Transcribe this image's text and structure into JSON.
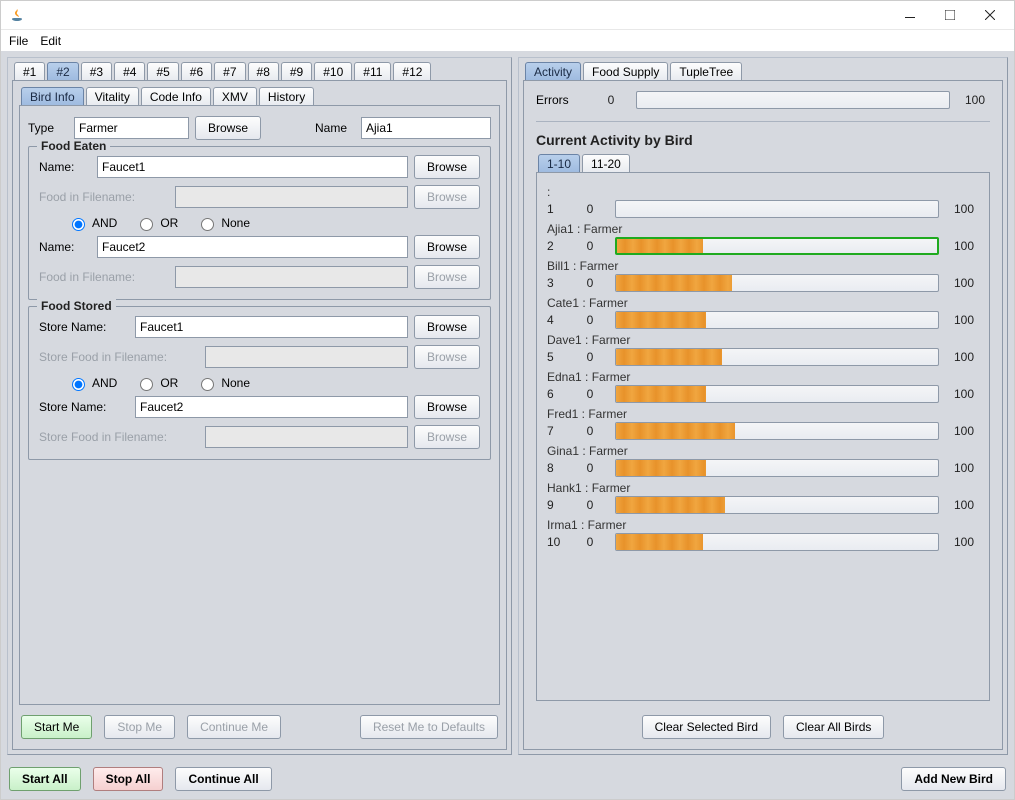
{
  "window": {
    "title": ""
  },
  "menu": {
    "items": [
      "File",
      "Edit"
    ]
  },
  "outer_tabs": [
    "#1",
    "#2",
    "#3",
    "#4",
    "#5",
    "#6",
    "#7",
    "#8",
    "#9",
    "#10",
    "#11",
    "#12"
  ],
  "outer_tabs_active": 1,
  "inner_tabs": [
    "Bird Info",
    "Vitality",
    "Code Info",
    "XMV",
    "History"
  ],
  "inner_tabs_active": 0,
  "bird_info": {
    "type_label": "Type",
    "type_value": "Farmer",
    "browse": "Browse",
    "name_label": "Name",
    "name_value": "Ajia1"
  },
  "food_eaten": {
    "legend": "Food Eaten",
    "name1_label": "Name:",
    "name1_value": "Faucet1",
    "file1_label": "Food in Filename:",
    "radio_and": "AND",
    "radio_or": "OR",
    "radio_none": "None",
    "radio_selected": "AND",
    "name2_label": "Name:",
    "name2_value": "Faucet2",
    "file2_label": "Food in Filename:",
    "browse": "Browse"
  },
  "food_stored": {
    "legend": "Food Stored",
    "store1_label": "Store Name:",
    "store1_value": "Faucet1",
    "file1_label": "Store Food in Filename:",
    "radio_and": "AND",
    "radio_or": "OR",
    "radio_none": "None",
    "radio_selected": "AND",
    "store2_label": "Store Name:",
    "store2_value": "Faucet2",
    "file2_label": "Store Food in Filename:",
    "browse": "Browse"
  },
  "bird_buttons": {
    "start": "Start Me",
    "stop": "Stop Me",
    "cont": "Continue Me",
    "reset": "Reset Me to Defaults"
  },
  "footer": {
    "start_all": "Start All",
    "stop_all": "Stop All",
    "cont_all": "Continue All",
    "add_bird": "Add New Bird"
  },
  "right_tabs": [
    "Activity",
    "Food Supply",
    "TupleTree"
  ],
  "right_tabs_active": 0,
  "errors": {
    "label": "Errors",
    "min": "0",
    "max": "100",
    "value": 0
  },
  "activity": {
    "title": "Current Activity by Bird",
    "page_tabs": [
      "1-10",
      "11-20"
    ],
    "page_active": 0,
    "birds": [
      {
        "num": "1",
        "label": ":",
        "min": "0",
        "max": "100",
        "pct": 0,
        "highlight": false
      },
      {
        "num": "2",
        "label": "Ajia1 : Farmer",
        "min": "0",
        "max": "100",
        "pct": 27,
        "highlight": true
      },
      {
        "num": "3",
        "label": "Bill1 : Farmer",
        "min": "0",
        "max": "100",
        "pct": 36,
        "highlight": false
      },
      {
        "num": "4",
        "label": "Cate1 : Farmer",
        "min": "0",
        "max": "100",
        "pct": 28,
        "highlight": false
      },
      {
        "num": "5",
        "label": "Dave1 : Farmer",
        "min": "0",
        "max": "100",
        "pct": 33,
        "highlight": false
      },
      {
        "num": "6",
        "label": "Edna1 : Farmer",
        "min": "0",
        "max": "100",
        "pct": 28,
        "highlight": false
      },
      {
        "num": "7",
        "label": "Fred1 : Farmer",
        "min": "0",
        "max": "100",
        "pct": 37,
        "highlight": false
      },
      {
        "num": "8",
        "label": "Gina1 : Farmer",
        "min": "0",
        "max": "100",
        "pct": 28,
        "highlight": false
      },
      {
        "num": "9",
        "label": "Hank1 : Farmer",
        "min": "0",
        "max": "100",
        "pct": 34,
        "highlight": false
      },
      {
        "num": "10",
        "label": "Irma1 : Farmer",
        "min": "0",
        "max": "100",
        "pct": 27,
        "highlight": false
      }
    ],
    "clear_selected": "Clear Selected Bird",
    "clear_all": "Clear All Birds"
  }
}
